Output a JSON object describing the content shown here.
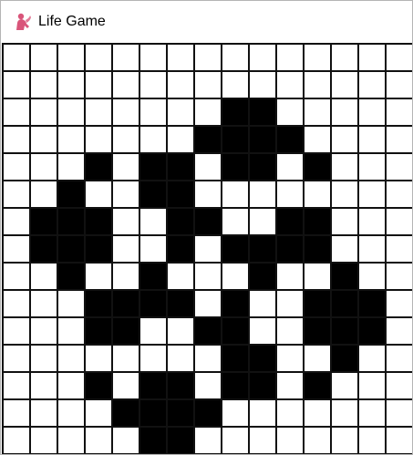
{
  "window": {
    "title": "Life Game",
    "icon": "pink-figure-icon",
    "accent_color": "#d9557a"
  },
  "board": {
    "rows": 15,
    "cols": 15,
    "alive_color": "#000000",
    "dead_color": "#ffffff",
    "grid_line_color": "#111111",
    "alive_cells": [
      [
        2,
        8
      ],
      [
        2,
        9
      ],
      [
        3,
        7
      ],
      [
        3,
        8
      ],
      [
        3,
        9
      ],
      [
        3,
        10
      ],
      [
        4,
        3
      ],
      [
        4,
        5
      ],
      [
        4,
        6
      ],
      [
        4,
        8
      ],
      [
        4,
        9
      ],
      [
        4,
        11
      ],
      [
        5,
        2
      ],
      [
        5,
        5
      ],
      [
        5,
        6
      ],
      [
        6,
        1
      ],
      [
        6,
        2
      ],
      [
        6,
        3
      ],
      [
        6,
        6
      ],
      [
        6,
        7
      ],
      [
        6,
        10
      ],
      [
        6,
        11
      ],
      [
        7,
        1
      ],
      [
        7,
        2
      ],
      [
        7,
        3
      ],
      [
        7,
        6
      ],
      [
        7,
        8
      ],
      [
        7,
        9
      ],
      [
        7,
        10
      ],
      [
        7,
        11
      ],
      [
        8,
        2
      ],
      [
        8,
        5
      ],
      [
        8,
        9
      ],
      [
        8,
        12
      ],
      [
        9,
        3
      ],
      [
        9,
        4
      ],
      [
        9,
        5
      ],
      [
        9,
        6
      ],
      [
        9,
        8
      ],
      [
        9,
        11
      ],
      [
        9,
        12
      ],
      [
        9,
        13
      ],
      [
        10,
        3
      ],
      [
        10,
        4
      ],
      [
        10,
        7
      ],
      [
        10,
        8
      ],
      [
        10,
        11
      ],
      [
        10,
        12
      ],
      [
        10,
        13
      ],
      [
        11,
        8
      ],
      [
        11,
        9
      ],
      [
        11,
        12
      ],
      [
        12,
        3
      ],
      [
        12,
        5
      ],
      [
        12,
        6
      ],
      [
        12,
        8
      ],
      [
        12,
        9
      ],
      [
        12,
        11
      ],
      [
        13,
        4
      ],
      [
        13,
        5
      ],
      [
        13,
        6
      ],
      [
        13,
        7
      ],
      [
        14,
        5
      ],
      [
        14,
        6
      ]
    ]
  }
}
